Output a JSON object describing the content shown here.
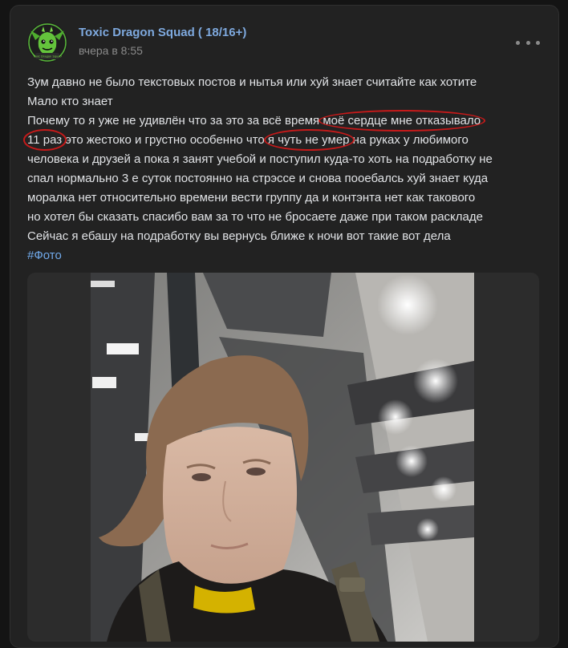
{
  "post": {
    "author": "Toxic Dragon Squad ( 18/16+)",
    "time": "вчера в 8:55",
    "menu_icon": "more-horizontal-icon",
    "lines": [
      [
        {
          "t": "Зум давно не было текстовых постов и нытья или хуй знает считайте как хотите"
        }
      ],
      [
        {
          "t": "Мало кто знает"
        }
      ],
      [
        {
          "t": "Почему то я уже не удивлён что за это за всё время "
        },
        {
          "t": "моё сердце мне отказывало",
          "mark": true
        }
      ],
      [
        {
          "t": "11 раз",
          "mark": true
        },
        {
          "t": " это жестоко и грустно особенно что "
        },
        {
          "t": "я чуть не умер",
          "mark": true
        },
        {
          "t": " на руках у любимого"
        }
      ],
      [
        {
          "t": "человека и друзей а пока я занят учебой и поступил куда-то хоть на подработку не"
        }
      ],
      [
        {
          "t": "спал нормально 3 е суток постоянно на стрэссе и снова пооебалсь хуй знает куда"
        }
      ],
      [
        {
          "t": "моралка нет относительно времени вести группу да и контэнта нет как такового"
        }
      ],
      [
        {
          "t": "но хотел бы сказать спасибо вам за то что не бросаете даже при таком раскладе"
        }
      ],
      [
        {
          "t": "Сейчас я ебашу на подработку вы вернусь ближе к ночи вот такие вот дела"
        }
      ]
    ],
    "hashtag": "#Фото",
    "avatar_text": "Toxic Dragon Squad"
  },
  "colors": {
    "page_bg": "#141414",
    "card_bg": "#222222",
    "author": "#7ea9de",
    "text": "#e1e3e6",
    "meta": "#8a8a8a",
    "hashtag": "#71aaeb",
    "annotation": "#c61a1a"
  }
}
